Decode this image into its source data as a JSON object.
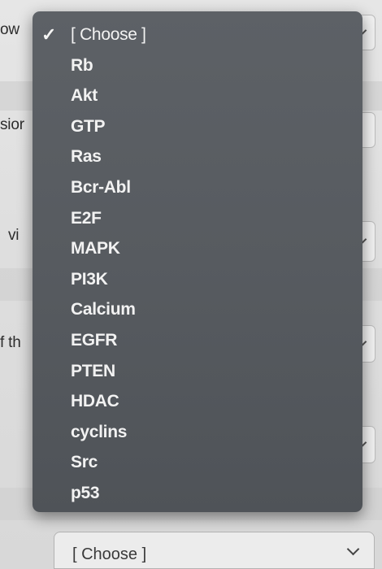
{
  "background": {
    "fragments": [
      "ow",
      "sior",
      "vi",
      "f th"
    ],
    "bottom_select": {
      "value": "[ Choose ]"
    }
  },
  "dropdown": {
    "check_icon": "checkmark-icon",
    "selected_index": 0,
    "options": [
      "[ Choose ]",
      "Rb",
      "Akt",
      "GTP",
      "Ras",
      "Bcr-Abl",
      "E2F",
      "MAPK",
      "PI3K",
      "Calcium",
      "EGFR",
      "PTEN",
      "HDAC",
      "cyclins",
      "Src",
      "p53"
    ]
  },
  "colors": {
    "menu_bg": "#575b60",
    "menu_text": "#f2f2f2",
    "page_bg": "#e0e0e0"
  }
}
